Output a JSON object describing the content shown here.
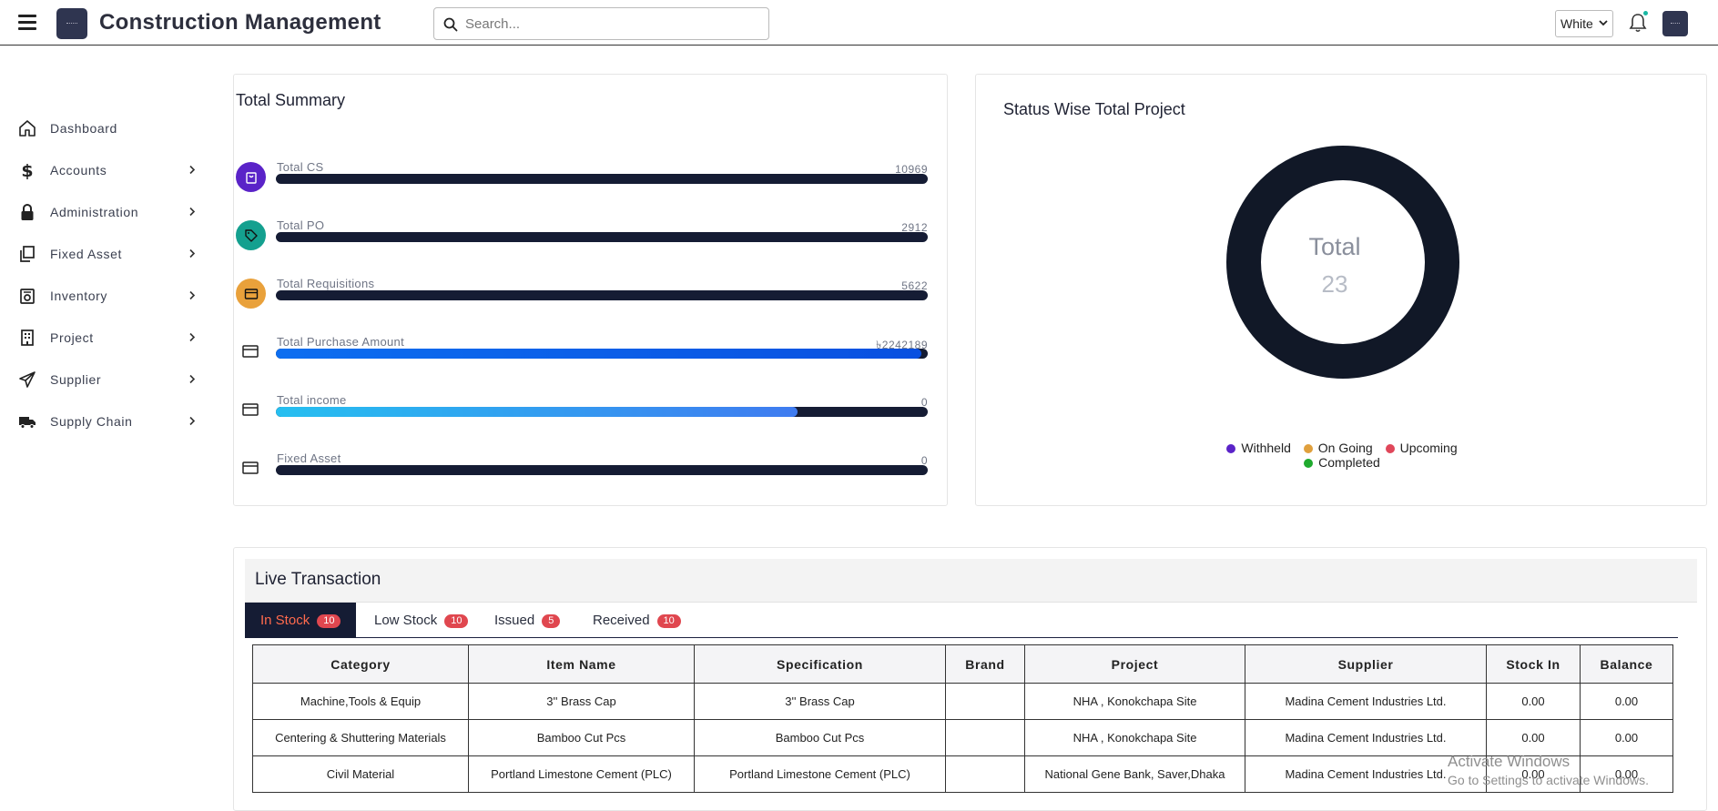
{
  "header": {
    "title": "Construction Management",
    "search_placeholder": "Search...",
    "theme_value": "White"
  },
  "sidebar": {
    "items": [
      {
        "label": "Dashboard",
        "icon": "home-icon",
        "has_submenu": false
      },
      {
        "label": "Accounts",
        "icon": "dollar-icon",
        "has_submenu": true
      },
      {
        "label": "Administration",
        "icon": "lock-icon",
        "has_submenu": true
      },
      {
        "label": "Fixed Asset",
        "icon": "copy-icon",
        "has_submenu": true
      },
      {
        "label": "Inventory",
        "icon": "inventory-icon",
        "has_submenu": true
      },
      {
        "label": "Project",
        "icon": "building-icon",
        "has_submenu": true
      },
      {
        "label": "Supplier",
        "icon": "paper-plane-icon",
        "has_submenu": true
      },
      {
        "label": "Supply Chain",
        "icon": "truck-icon",
        "has_submenu": true
      }
    ]
  },
  "summary": {
    "title": "Total Summary",
    "rows": [
      {
        "label": "Total CS",
        "value": "10969",
        "progress": 0.0,
        "icon": "shopping-bag-icon",
        "badge_color": "#5a23c8"
      },
      {
        "label": "Total PO",
        "value": "2912",
        "progress": 0.0,
        "icon": "tag-icon",
        "badge_color": "#14a08f"
      },
      {
        "label": "Total Requisitions",
        "value": "5622",
        "progress": 0.0,
        "icon": "card-icon",
        "badge_color": "#e9a13b"
      },
      {
        "label": "Total Purchase Amount",
        "value": "৳2242189",
        "progress": 0.99,
        "icon": "credit-card-icon",
        "badge_color": ""
      },
      {
        "label": "Total income",
        "value": "0",
        "progress": 0.8,
        "icon": "credit-card-icon",
        "badge_color": ""
      },
      {
        "label": "Fixed Asset",
        "value": "0",
        "progress": 0.0,
        "icon": "credit-card-icon",
        "badge_color": ""
      }
    ]
  },
  "status_chart": {
    "title": "Status Wise Total Project",
    "center_label": "Total",
    "center_value": "23",
    "legend": [
      {
        "name": "Withheld",
        "color": "#5a23c8"
      },
      {
        "name": "On Going",
        "color": "#e0a03d"
      },
      {
        "name": "Upcoming",
        "color": "#e0475a"
      },
      {
        "name": "Completed",
        "color": "#1faa2e"
      }
    ],
    "ring_color": "#111827"
  },
  "chart_data": {
    "type": "pie",
    "title": "Status Wise Total Project",
    "categories": [
      "Withheld",
      "On Going",
      "Upcoming",
      "Completed"
    ],
    "total": 23,
    "legend_position": "bottom"
  },
  "live": {
    "title": "Live Transaction",
    "tabs": [
      {
        "label": "In Stock",
        "count": "10",
        "active": true
      },
      {
        "label": "Low Stock",
        "count": "10",
        "active": false
      },
      {
        "label": "Issued",
        "count": "5",
        "active": false
      },
      {
        "label": "Received",
        "count": "10",
        "active": false
      }
    ],
    "columns": [
      "Category",
      "Item Name",
      "Specification",
      "Brand",
      "Project",
      "Supplier",
      "Stock In",
      "Balance"
    ],
    "rows": [
      [
        "Machine,Tools & Equip",
        "3'' Brass Cap",
        "3'' Brass Cap",
        "",
        "NHA , Konokchapa Site",
        "Madina Cement Industries Ltd.",
        "0.00",
        "0.00"
      ],
      [
        "Centering & Shuttering Materials",
        "Bamboo Cut Pcs",
        "Bamboo Cut Pcs",
        "",
        "NHA , Konokchapa Site",
        "Madina Cement Industries Ltd.",
        "0.00",
        "0.00"
      ],
      [
        "Civil Material",
        "Portland Limestone Cement (PLC)",
        "Portland Limestone Cement (PLC)",
        "",
        "National Gene Bank, Saver,Dhaka",
        "Madina Cement Industries Ltd.",
        "0.00",
        "0.00"
      ]
    ]
  },
  "watermark": {
    "line1": "Activate Windows",
    "line2": "Go to Settings to activate Windows."
  }
}
